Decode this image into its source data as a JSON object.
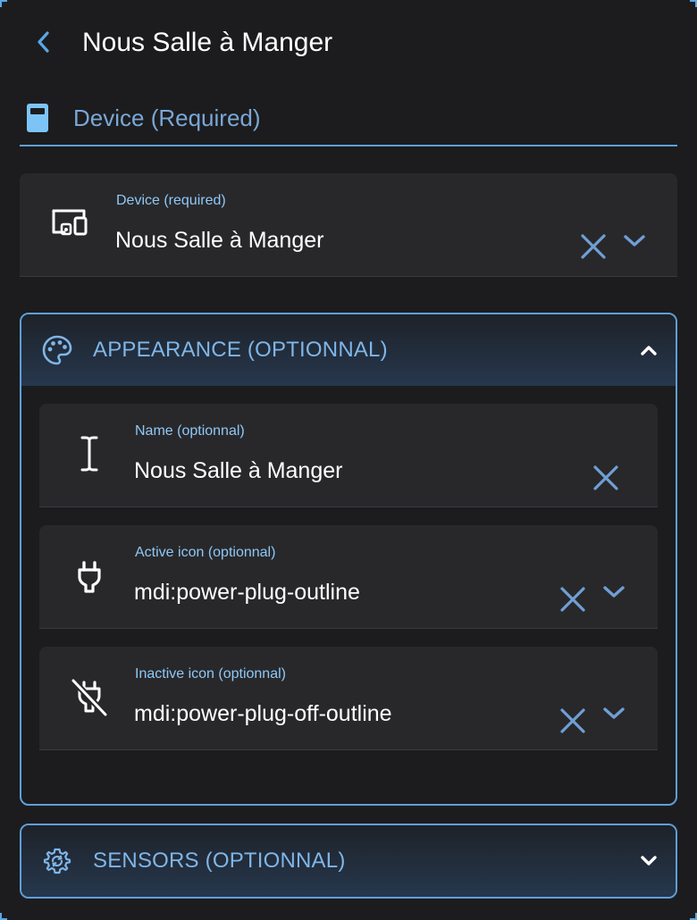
{
  "header": {
    "title": "Nous Salle à Manger",
    "back_icon": "chevron-left-icon"
  },
  "section_tab": {
    "label": "Device (Required)",
    "icon": "device-box-icon"
  },
  "device_field": {
    "label": "Device (required)",
    "value": "Nous Salle à Manger",
    "icon": "devices-icon"
  },
  "appearance": {
    "title": "APPEARANCE (OPTIONNAL)",
    "icon": "palette-icon",
    "expanded": true,
    "fields": [
      {
        "label": "Name (optionnal)",
        "value": "Nous Salle à Manger",
        "icon": "text-cursor-icon"
      },
      {
        "label": "Active icon (optionnal)",
        "value": "mdi:power-plug-outline",
        "icon": "power-plug-outline-icon"
      },
      {
        "label": "Inactive icon (optionnal)",
        "value": "mdi:power-plug-off-outline",
        "icon": "power-plug-off-outline-icon"
      }
    ]
  },
  "sensors": {
    "title": "SENSORS (OPTIONNAL)",
    "icon": "cog-sync-icon",
    "expanded": false
  },
  "colors": {
    "background": "#1c1c1e",
    "field_bg": "#28282b",
    "accent": "#5f9fd8",
    "label": "#8fc8f6",
    "clear_icon": "#6f9fd4"
  }
}
